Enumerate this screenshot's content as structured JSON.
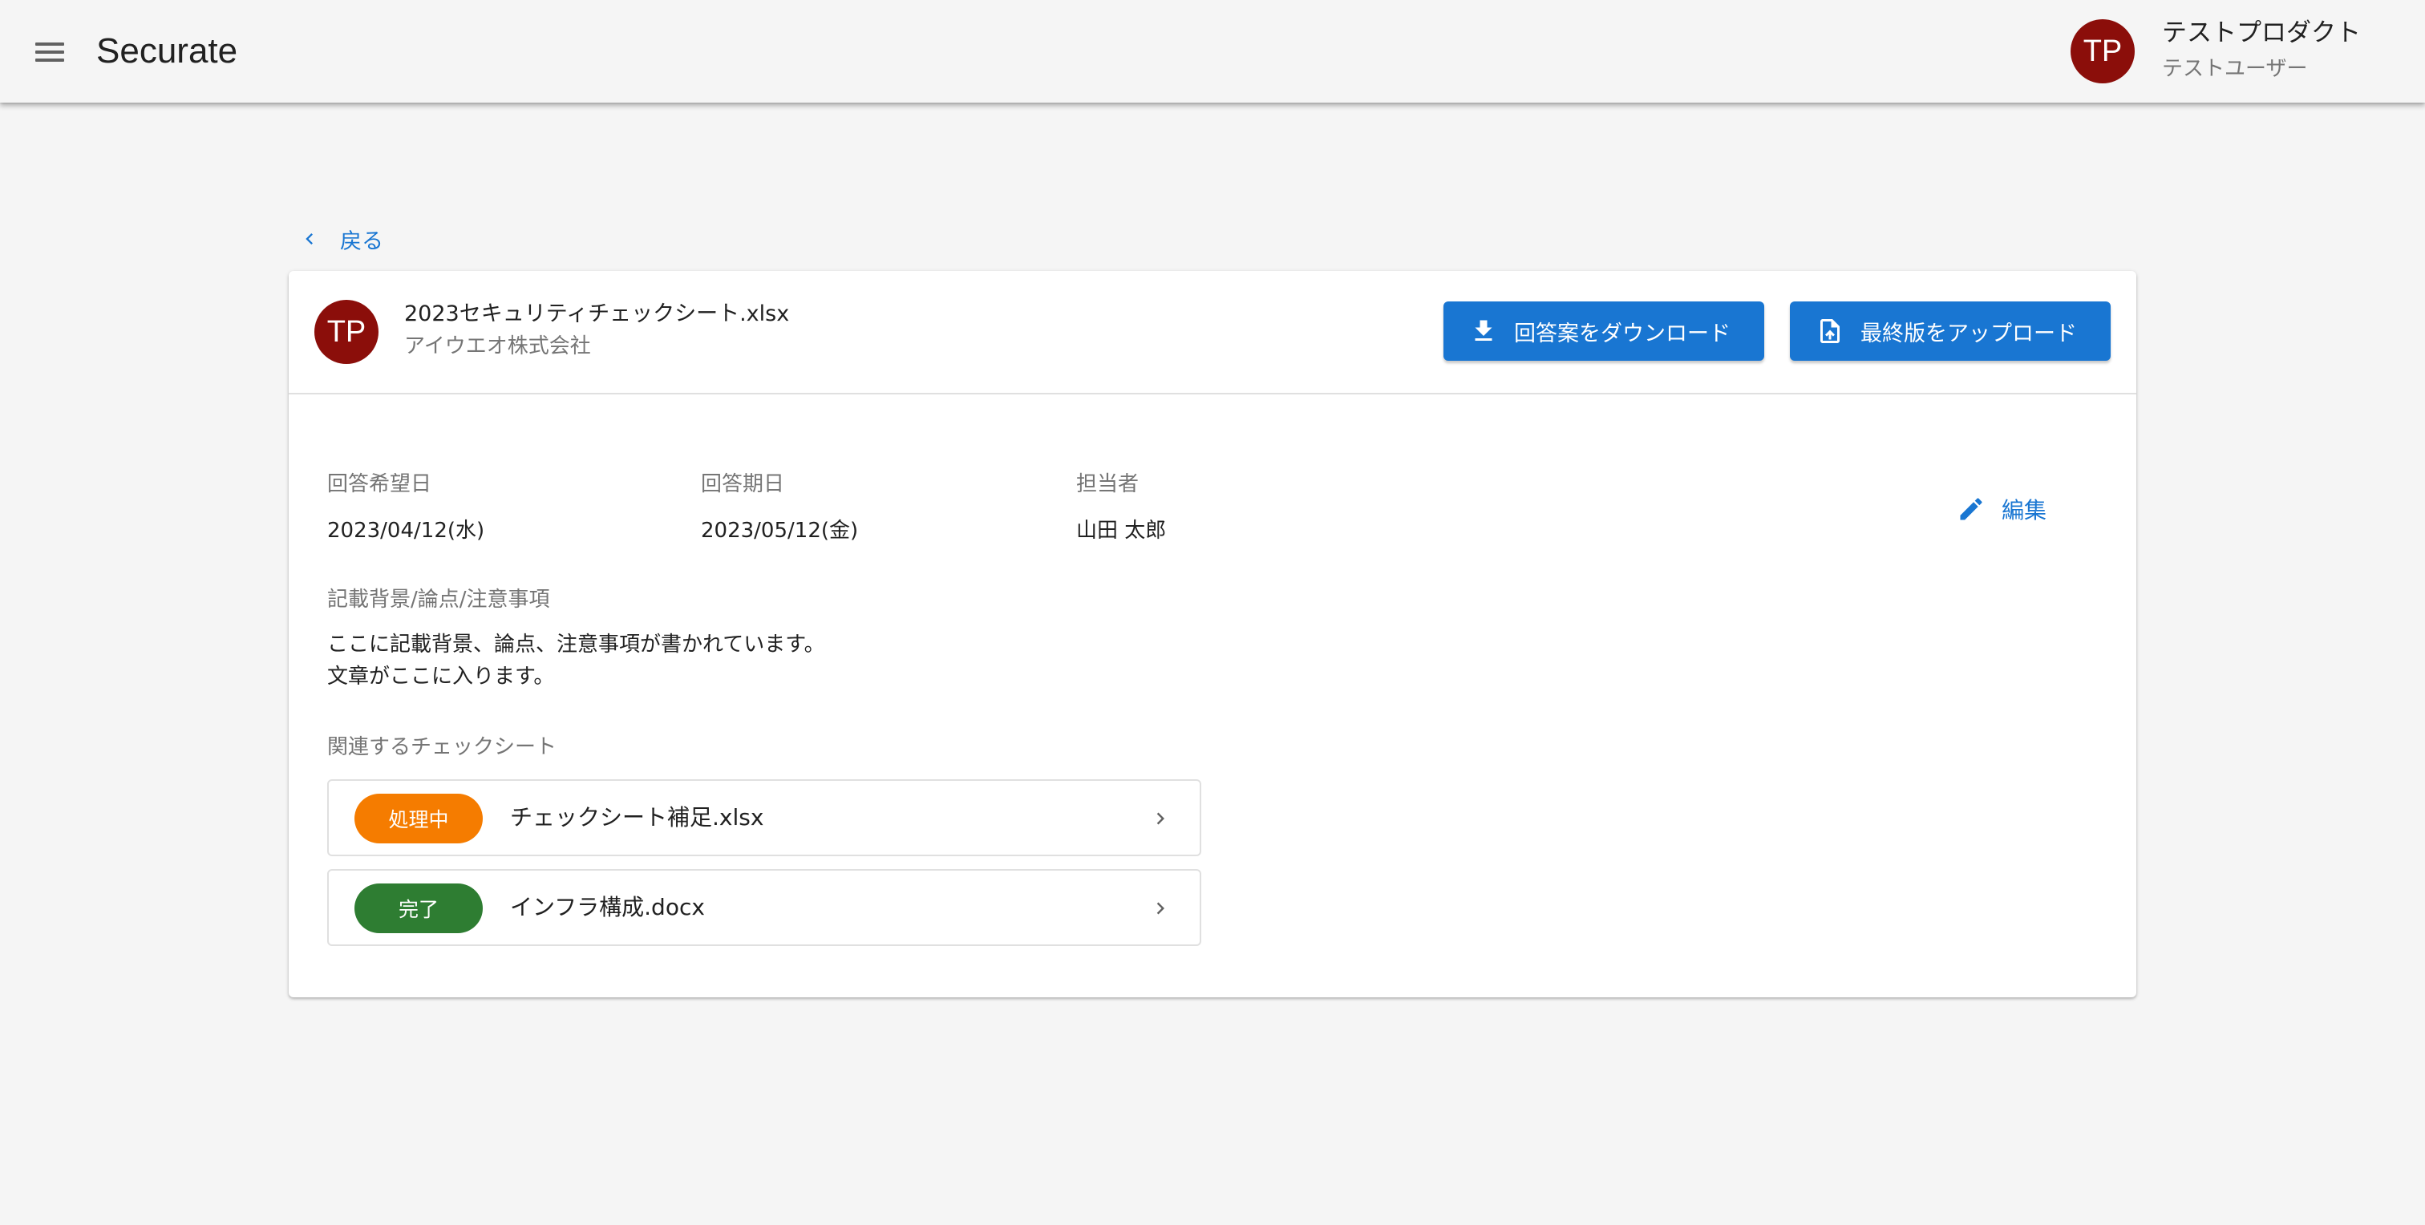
{
  "app": {
    "title": "Securate"
  },
  "header": {
    "product_name": "テストプロダクト",
    "user_name": "テストユーザー",
    "avatar_initials": "TP"
  },
  "back": {
    "label": "戻る"
  },
  "sheet": {
    "avatar_initials": "TP",
    "file_name": "2023セキュリティチェックシート.xlsx",
    "company": "アイウエオ株式会社",
    "download_label": "回答案をダウンロード",
    "upload_label": "最終版をアップロード"
  },
  "details": {
    "desired_date_label": "回答希望日",
    "desired_date_value": "2023/04/12(水)",
    "due_date_label": "回答期日",
    "due_date_value": "2023/05/12(金)",
    "assignee_label": "担当者",
    "assignee_value": "山田 太郎",
    "edit_label": "編集",
    "notes_label": "記載背景/論点/注意事項",
    "notes_line1": "ここに記載背景、論点、注意事項が書かれています。",
    "notes_line2": "文章がここに入ります。"
  },
  "related": {
    "label": "関連するチェックシート",
    "items": [
      {
        "status": "処理中",
        "status_color": "#f57c00",
        "name": "チェックシート補足.xlsx"
      },
      {
        "status": "完了",
        "status_color": "#2e7d32",
        "name": "インフラ構成.docx"
      }
    ]
  },
  "colors": {
    "primary": "#1976d2",
    "avatar": "#8b0e0a",
    "background": "#f5f5f5"
  },
  "icons": {
    "menu": "menu-icon",
    "back": "chevron-left-icon",
    "download": "download-icon",
    "upload": "file-upload-icon",
    "edit": "pencil-icon",
    "row_arrow": "chevron-right-icon"
  }
}
